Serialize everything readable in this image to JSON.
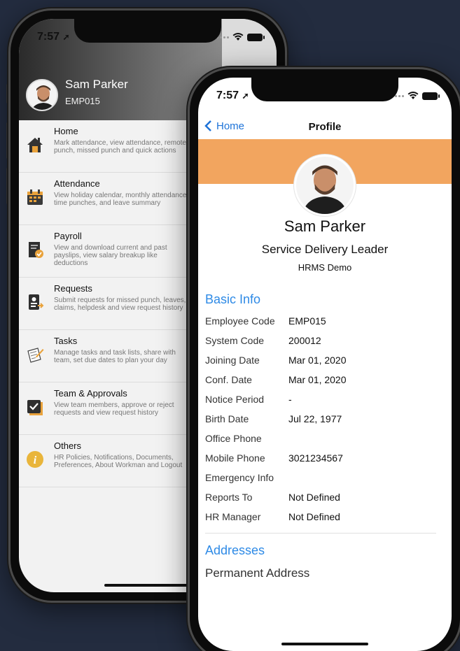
{
  "back_phone": {
    "status_time": "7:57",
    "user": {
      "name": "Sam Parker",
      "code": "EMP015"
    },
    "menu": [
      {
        "title": "Home",
        "desc": "Mark attendance, view attendance, remote punch, missed punch and quick actions",
        "icon": "house-icon",
        "color": "#333333"
      },
      {
        "title": "Attendance",
        "desc": "View holiday calendar, monthly attendance, time punches, and leave summary",
        "icon": "calendar-icon",
        "color": "#e9a23b"
      },
      {
        "title": "Payroll",
        "desc": "View and download current and past payslips, view salary breakup like deductions",
        "icon": "payslip-icon",
        "color": "#e9a23b"
      },
      {
        "title": "Requests",
        "desc": "Submit requests for missed punch, leaves, claims, helpdesk and view request history",
        "icon": "request-icon",
        "color": "#e9a23b"
      },
      {
        "title": "Tasks",
        "desc": "Manage tasks and task lists, share with team, set due dates to plan your day",
        "icon": "tasks-icon",
        "color": "#e9a23b"
      },
      {
        "title": "Team & Approvals",
        "desc": "View team members, approve or reject requests and view request history",
        "icon": "checkbox-icon",
        "color": "#e9a23b"
      },
      {
        "title": "Others",
        "desc": "HR Policies, Notifications, Documents, Preferences, About Workman and Logout",
        "icon": "info-icon",
        "color": "#e9b53b"
      }
    ]
  },
  "front_phone": {
    "status_time": "7:57",
    "nav": {
      "back_label": "Home",
      "title": "Profile"
    },
    "profile": {
      "name": "Sam Parker",
      "role": "Service Delivery Leader",
      "company": "HRMS Demo"
    },
    "basic_info_title": "Basic Info",
    "basic_info": [
      {
        "label": "Employee Code",
        "value": "EMP015"
      },
      {
        "label": "System Code",
        "value": "200012"
      },
      {
        "label": "Joining Date",
        "value": "Mar 01, 2020"
      },
      {
        "label": "Conf. Date",
        "value": "Mar 01, 2020"
      },
      {
        "label": "Notice Period",
        "value": "-"
      },
      {
        "label": "Birth Date",
        "value": "Jul 22, 1977"
      },
      {
        "label": "Office Phone",
        "value": ""
      },
      {
        "label": "Mobile Phone",
        "value": "3021234567"
      },
      {
        "label": "Emergency Info",
        "value": ""
      },
      {
        "label": "Reports To",
        "value": "Not Defined"
      },
      {
        "label": "HR Manager",
        "value": "Not Defined"
      }
    ],
    "addresses_title": "Addresses",
    "permanent_address_label": "Permanent Address"
  },
  "colors": {
    "background": "#232c3f",
    "accent_blue": "#2e8ae6",
    "banner_orange": "#f2a55f",
    "icon_orange": "#e9a23b"
  }
}
